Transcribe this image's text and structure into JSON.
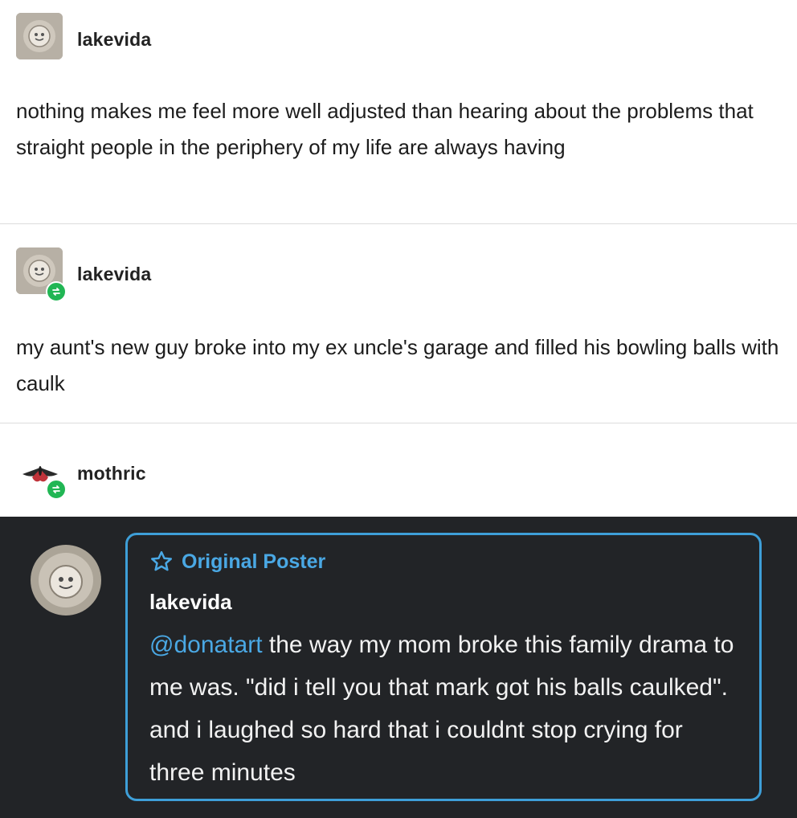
{
  "posts": [
    {
      "username": "lakevida",
      "text": "nothing makes me feel more well adjusted than hearing about the problems that straight people in the periphery of my life are always having"
    },
    {
      "username": "lakevida",
      "text": "my aunt's new guy broke into my ex uncle's garage and filled his bowling balls with caulk"
    },
    {
      "username": "mothric"
    }
  ],
  "reply": {
    "badge_label": "Original Poster",
    "username": "lakevida",
    "mention": "@donatart",
    "text": " the way my mom broke this family drama to me was. \"did i tell you that mark got his balls caulked\". and i laughed so hard that i couldnt stop crying for three minutes"
  },
  "colors": {
    "reblog_badge": "#21b654",
    "dark_background": "#222427",
    "accent_blue": "#4aa8e4"
  },
  "icons": {
    "reblog": "reblog-icon",
    "star": "star-icon"
  }
}
